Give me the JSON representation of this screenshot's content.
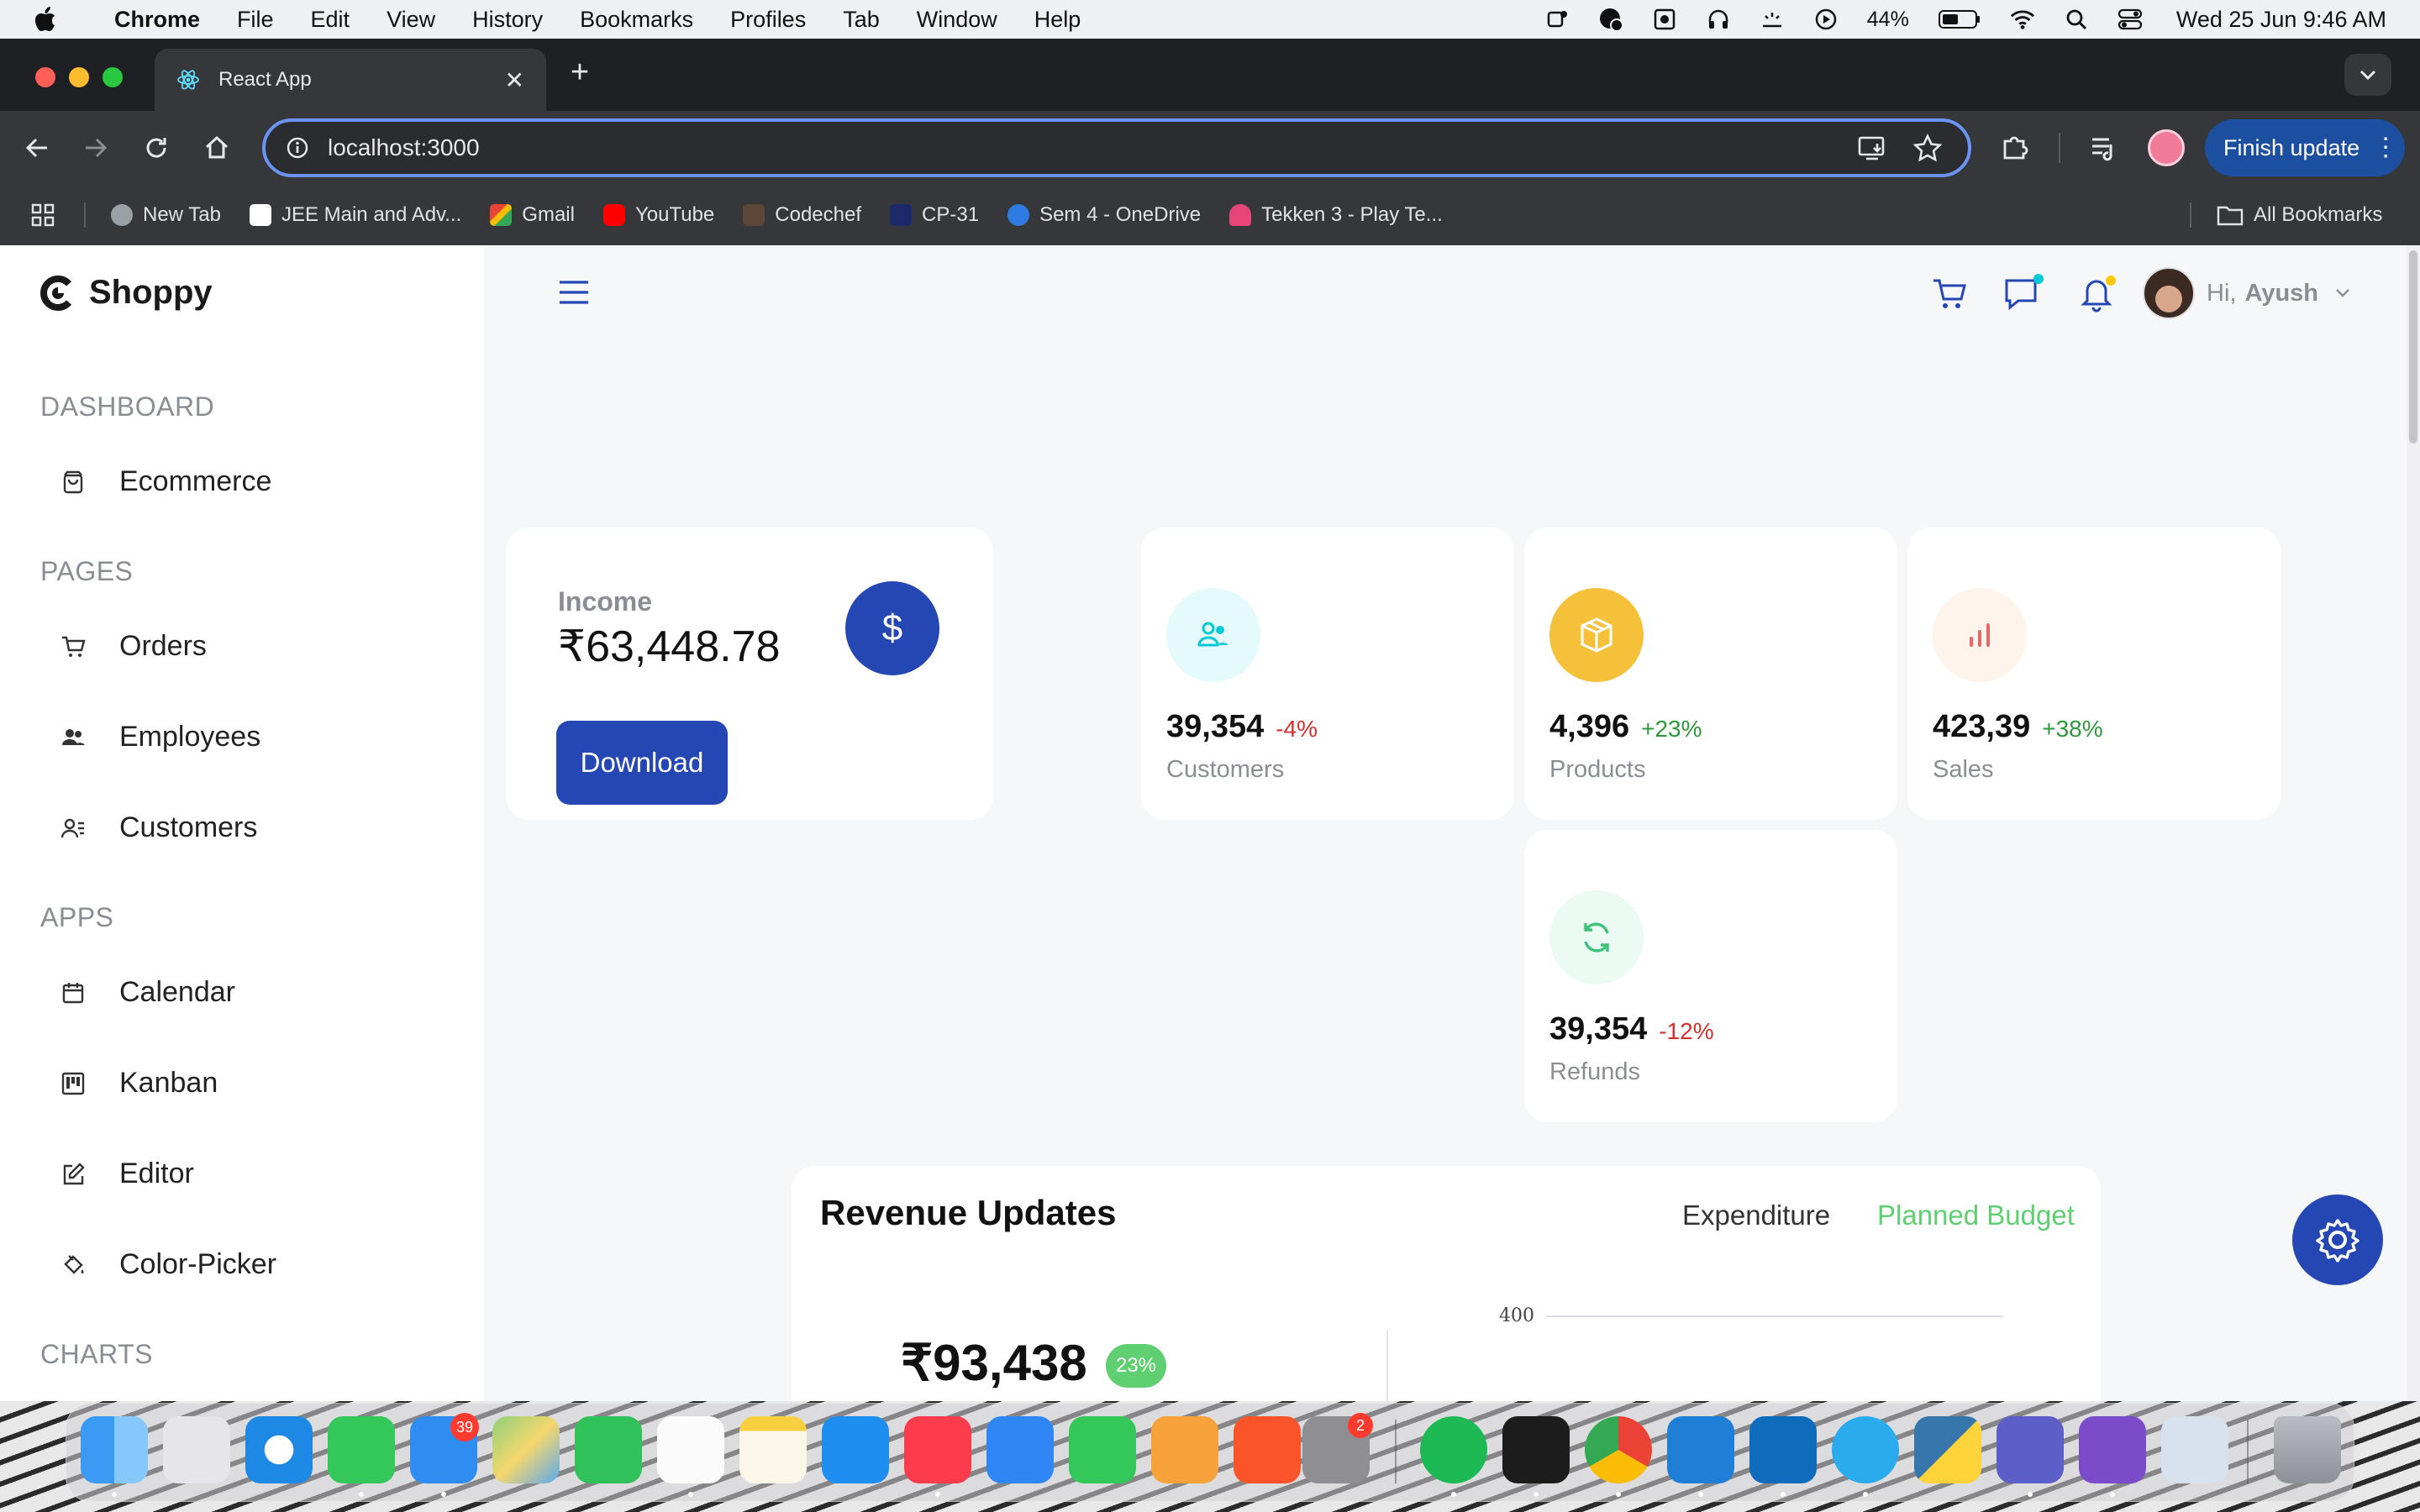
{
  "menubar": {
    "app_name": "Chrome",
    "menus": [
      "File",
      "Edit",
      "View",
      "History",
      "Bookmarks",
      "Profiles",
      "Tab",
      "Window",
      "Help"
    ],
    "battery": "44%",
    "datetime": "Wed 25 Jun  9:46 AM"
  },
  "browser": {
    "tab_title": "React App",
    "url": "localhost:3000",
    "finish_update": "Finish update",
    "bookmarks": [
      "New Tab",
      "JEE Main and Adv...",
      "Gmail",
      "YouTube",
      "Codechef",
      "CP-31",
      "Sem 4 - OneDrive",
      "Tekken 3 - Play Te..."
    ],
    "all_bookmarks": "All Bookmarks"
  },
  "sidebar": {
    "brand": "Shoppy",
    "sections": [
      {
        "title": "DASHBOARD",
        "items": [
          {
            "label": "Ecommerce",
            "icon": "bag-icon"
          }
        ]
      },
      {
        "title": "PAGES",
        "items": [
          {
            "label": "Orders",
            "icon": "cart-icon"
          },
          {
            "label": "Employees",
            "icon": "people-icon"
          },
          {
            "label": "Customers",
            "icon": "contacts-icon"
          }
        ]
      },
      {
        "title": "APPS",
        "items": [
          {
            "label": "Calendar",
            "icon": "calendar-icon"
          },
          {
            "label": "Kanban",
            "icon": "kanban-icon"
          },
          {
            "label": "Editor",
            "icon": "edit-icon"
          },
          {
            "label": "Color-Picker",
            "icon": "bucket-icon"
          }
        ]
      },
      {
        "title": "CHARTS",
        "items": []
      }
    ]
  },
  "header": {
    "greeting": "Hi,",
    "user": "Ayush"
  },
  "income": {
    "label": "Income",
    "value": "₹63,448.78",
    "button": "Download",
    "icon_symbol": "$"
  },
  "stats": [
    {
      "value": "39,354",
      "pct": "-4%",
      "label": "Customers",
      "pct_color": "#d32f2f",
      "icon": "customers-icon"
    },
    {
      "value": "4,396",
      "pct": "+23%",
      "label": "Products",
      "pct_color": "#2e9a3c",
      "icon": "box-icon"
    },
    {
      "value": "423,39",
      "pct": "+38%",
      "label": "Sales",
      "pct_color": "#2e9a3c",
      "icon": "bar-chart-icon"
    },
    {
      "value": "39,354",
      "pct": "-12%",
      "label": "Refunds",
      "pct_color": "#d32f2f",
      "icon": "refresh-icon"
    }
  ],
  "revenue": {
    "title": "Revenue Updates",
    "legend_expenditure": "Expenditure",
    "legend_planned": "Planned Budget",
    "amount": "₹93,438",
    "badge": "23%",
    "axis_tick": "400"
  },
  "colors": {
    "accent": "#2547b4",
    "green": "#5fcf72"
  }
}
